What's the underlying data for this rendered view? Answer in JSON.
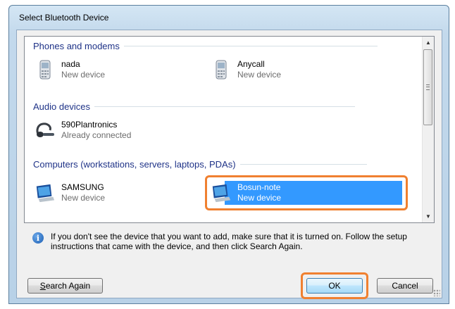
{
  "window": {
    "title": "Select Bluetooth Device"
  },
  "groups": [
    {
      "label": "Phones and modems",
      "devices": [
        {
          "name": "nada",
          "status": "New device",
          "icon": "phone-icon"
        },
        {
          "name": "Anycall",
          "status": "New device",
          "icon": "phone-icon"
        }
      ]
    },
    {
      "label": "Audio devices",
      "devices": [
        {
          "name": "590Plantronics",
          "status": "Already connected",
          "icon": "headset-icon"
        }
      ]
    },
    {
      "label": "Computers (workstations, servers, laptops, PDAs)",
      "devices": [
        {
          "name": "SAMSUNG",
          "status": "New device",
          "icon": "computer-icon"
        },
        {
          "name": "Bosun-note",
          "status": "New device",
          "icon": "computer-icon",
          "selected": true
        }
      ]
    }
  ],
  "info": {
    "text": "If you don't see the device that you want to add, make sure that it is turned on. Follow the setup instructions that came with the device, and then click Search Again."
  },
  "buttons": {
    "search_again_prefix": "S",
    "search_again_rest": "earch Again",
    "ok": "OK",
    "cancel": "Cancel"
  },
  "colors": {
    "selection": "#3399ff",
    "highlight_ring": "#f08030",
    "group_header": "#1e3287"
  }
}
